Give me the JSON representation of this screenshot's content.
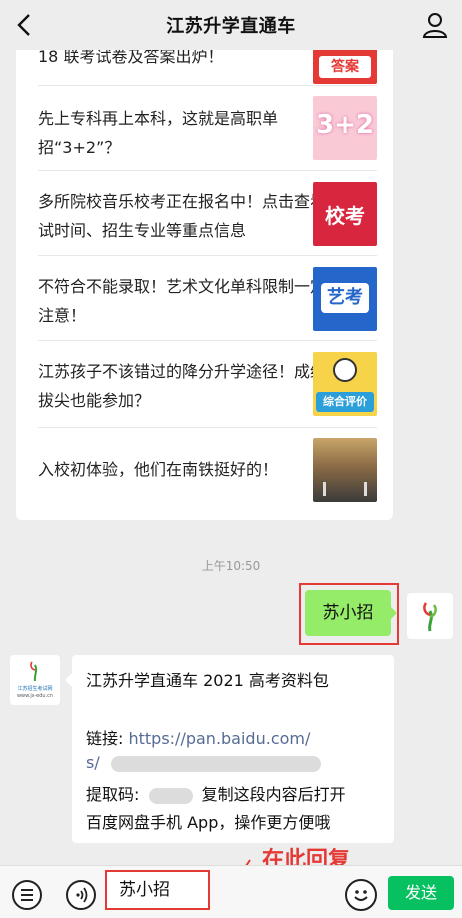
{
  "header": {
    "title": "江苏升学直通车"
  },
  "articles": [
    {
      "text": "18 联考试卷及答案出炉！",
      "thumb": "答案"
    },
    {
      "text": "先上专科再上本科，这就是高职单招“3+2”？",
      "thumb": "3+2"
    },
    {
      "text": "多所院校音乐校考正在报名中！点击查看考试时间、招生专业等重点信息",
      "thumb": "校考"
    },
    {
      "text": "不符合不能录取！艺术文化单科限制一定要注意！",
      "thumb": "艺考"
    },
    {
      "text": "江苏孩子不该错过的降分升学途径！成绩不拔尖也能参加？",
      "thumb": "综合评价"
    },
    {
      "text": "入校初体验，他们在南铁挺好的！",
      "thumb": ""
    }
  ],
  "chat": {
    "timestamp": "上午10:50",
    "sent_message": "苏小招",
    "bot_avatar": {
      "name": "江苏招生考试网",
      "url": "www.js-edu.cn"
    },
    "received": {
      "line1": "江苏升学直通车 2021 高考资料包",
      "link_label": "链接: ",
      "link_line1": "https://pan.baidu.com/",
      "link_line2": "s/",
      "code_label": "提取码:",
      "code_suffix": "复制这段内容后打开",
      "line_last": "百度网盘手机 App，操作更方便哦"
    }
  },
  "input": {
    "value": "苏小招"
  },
  "annotation": "在此回复",
  "send_label": "发送"
}
